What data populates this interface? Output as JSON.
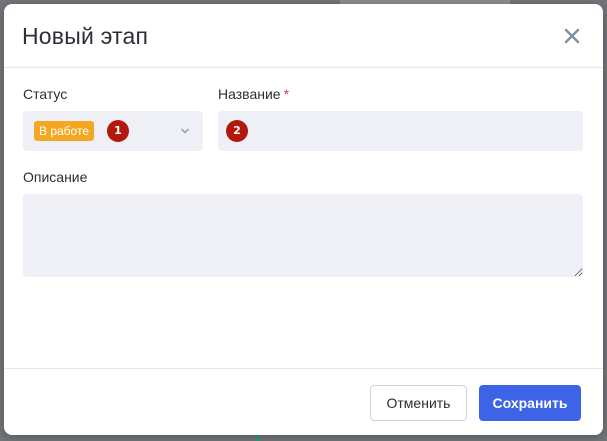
{
  "dialog": {
    "title": "Новый этап",
    "close_icon": "close-icon"
  },
  "form": {
    "status": {
      "label": "Статус",
      "selected": "В работе",
      "badge_color": "#f5a623",
      "marker": "1"
    },
    "name": {
      "label": "Название",
      "required_mark": "*",
      "value": "",
      "marker": "2"
    },
    "description": {
      "label": "Описание",
      "value": ""
    }
  },
  "footer": {
    "cancel_label": "Отменить",
    "save_label": "Сохранить"
  },
  "colors": {
    "accent": "#3d63e6",
    "marker": "#b3180d",
    "required": "#e0344a"
  }
}
